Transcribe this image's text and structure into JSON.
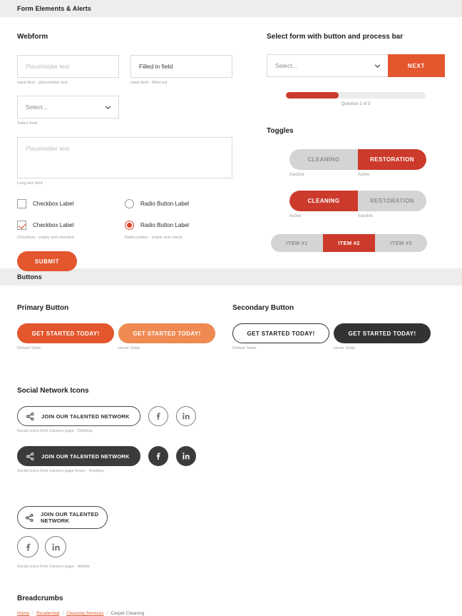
{
  "sections": {
    "forms_bar": "Form Elements & Alerts",
    "buttons_bar": "Buttons"
  },
  "webform": {
    "title": "Webform",
    "input_placeholder": "Placeholder text",
    "input_placeholder_caption": "Input field - placeholder text",
    "input_filled_value": "Filled in field",
    "input_filled_caption": "Input field - filled out",
    "select_value": "Select...",
    "select_caption": "Select field",
    "textarea_placeholder": "Placeholder text",
    "textarea_caption": "Long text field",
    "checkbox_label_empty": "Checkbox Label",
    "checkbox_label_checked": "Checkbox Label",
    "checkbox_caption": "Checkbox - empty and checked",
    "radio_label_empty": "Radio Button Label",
    "radio_label_checked": "Radio Button Label",
    "radio_caption": "Radio button - empty and check",
    "submit_label": "SUBMIT"
  },
  "select_process": {
    "title": "Select form with button and process bar",
    "select_value": "Select...",
    "next_label": "NEXT",
    "progress_percent": 38,
    "progress_caption": "Question 1 of 3"
  },
  "toggles": {
    "title": "Toggles",
    "toggle_one": {
      "left_label": "CLEANING",
      "right_label": "RESTORATION",
      "left_state": "Inactive",
      "right_state": "Active"
    },
    "toggle_two": {
      "left_label": "CLEANING",
      "right_label": "RESTORATION",
      "left_state": "Active",
      "right_state": "Inactive"
    },
    "tabs": [
      {
        "label": "ITEM #1",
        "active": false
      },
      {
        "label": "ITEM #2",
        "active": true
      },
      {
        "label": "ITEM #3",
        "active": false
      }
    ]
  },
  "buttons": {
    "primary_title": "Primary Button",
    "secondary_title": "Secondary Button",
    "cta_label": "GET STARTED TODAY!",
    "default_state": "Default State",
    "hover_state": "Hover State"
  },
  "social": {
    "title": "Social Network Icons",
    "join_label": "JOIN OUR TALENTED NETWORK",
    "join_label_mobile_line1": "JOIN OUR TALENTED",
    "join_label_mobile_line2": "NETWORK",
    "caption_desktop": "Social icons from Careers page - Desktop",
    "caption_desktop_hover": "Social icons from Careers page hover - Desktop",
    "caption_mobile": "Social icons from Careers page - Mobile",
    "icons": {
      "share": "share-icon",
      "facebook": "facebook-icon",
      "linkedin": "linkedin-icon"
    }
  },
  "breadcrumbs": {
    "title": "Breadcrumbs",
    "items": [
      {
        "label": "Home",
        "link": true
      },
      {
        "label": "Residential",
        "link": true
      },
      {
        "label": "Cleaning Services",
        "link": true
      },
      {
        "label": "Carpet Cleaning",
        "link": false
      }
    ],
    "separator": "/"
  },
  "colors": {
    "primary_orange": "#e4562e",
    "hover_orange": "#ef8a53",
    "toggle_red": "#cc3a2b",
    "dark": "#3b3b3b",
    "bar_gray": "#ededed"
  }
}
